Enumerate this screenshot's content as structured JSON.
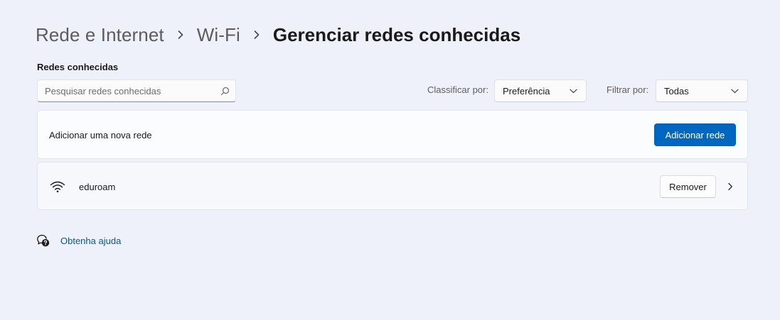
{
  "breadcrumb": {
    "items": [
      "Rede e Internet",
      "Wi-Fi"
    ],
    "current": "Gerenciar redes conhecidas"
  },
  "known_networks": {
    "section_title": "Redes conhecidas",
    "search": {
      "placeholder": "Pesquisar redes conhecidas",
      "value": ""
    },
    "sort": {
      "label": "Classificar por:",
      "value": "Preferência"
    },
    "filter": {
      "label": "Filtrar por:",
      "value": "Todas"
    },
    "add_row": {
      "label": "Adicionar uma nova rede",
      "button_label": "Adicionar rede"
    },
    "networks": [
      {
        "name": "eduroam",
        "icon": "wifi-icon",
        "remove_label": "Remover"
      }
    ]
  },
  "help": {
    "icon": "get-help-icon",
    "label": "Obtenha ajuda"
  },
  "colors": {
    "background": "#eef1f9",
    "accent": "#0067c0",
    "link": "#005a9e"
  }
}
